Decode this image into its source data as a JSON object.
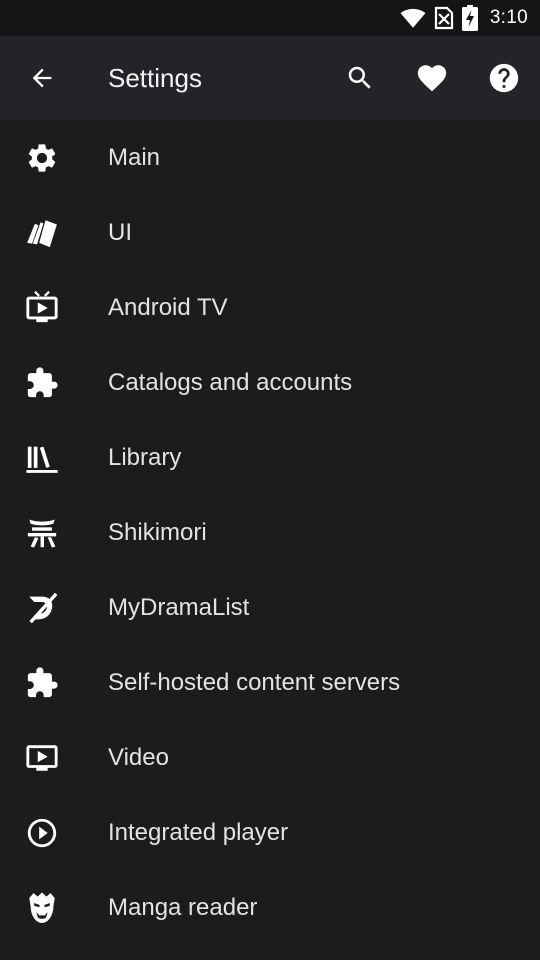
{
  "status_bar": {
    "time": "3:10",
    "icons": [
      "wifi-icon",
      "no-sim-icon",
      "battery-charging-icon"
    ]
  },
  "app_bar": {
    "title": "Settings",
    "back_icon": "arrow-back-icon",
    "actions": [
      "search-icon",
      "heart-icon",
      "help-icon"
    ]
  },
  "colors": {
    "background": "#1b1c1e",
    "app_bar": "#222427",
    "status_bar": "#141516",
    "text": "#e3e3e3",
    "icon": "#ffffff"
  },
  "items": [
    {
      "label": "Main",
      "icon": "gear-icon"
    },
    {
      "label": "UI",
      "icon": "cards-icon"
    },
    {
      "label": "Android TV",
      "icon": "tv-icon"
    },
    {
      "label": "Catalogs and accounts",
      "icon": "puzzle-icon"
    },
    {
      "label": "Library",
      "icon": "library-icon"
    },
    {
      "label": "Shikimori",
      "icon": "shikimori-icon"
    },
    {
      "label": "MyDramaList",
      "icon": "mydramalist-icon"
    },
    {
      "label": "Self-hosted content servers",
      "icon": "puzzle-icon"
    },
    {
      "label": "Video",
      "icon": "video-icon"
    },
    {
      "label": "Integrated player",
      "icon": "play-circle-icon"
    },
    {
      "label": "Manga reader",
      "icon": "manga-icon"
    }
  ]
}
